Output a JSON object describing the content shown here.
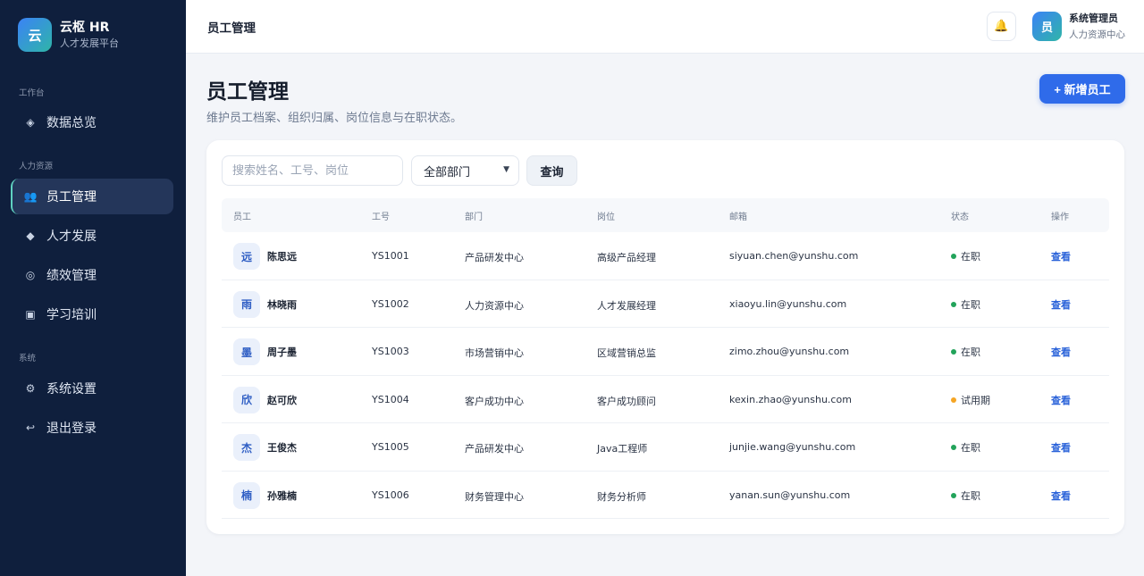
{
  "brand": {
    "logo": "云",
    "title": "云枢 HR",
    "subtitle": "人才发展平台"
  },
  "sidebar": {
    "sections": [
      "工作台",
      "人力资源",
      "系统"
    ],
    "items": [
      {
        "label": "数据总览",
        "icon": "diamond-icon",
        "glyph": "◈"
      },
      {
        "label": "员工管理",
        "icon": "people-icon",
        "glyph": "👥",
        "active": true
      },
      {
        "label": "人才发展",
        "icon": "diamond-solid-icon",
        "glyph": "◆"
      },
      {
        "label": "绩效管理",
        "icon": "target-icon",
        "glyph": "◎"
      },
      {
        "label": "学习培训",
        "icon": "square-icon",
        "glyph": "▣"
      },
      {
        "label": "系统设置",
        "icon": "gear-icon",
        "glyph": "⚙"
      },
      {
        "label": "退出登录",
        "icon": "logout-icon",
        "glyph": "↩"
      }
    ]
  },
  "topbar": {
    "title": "员工管理",
    "bell_icon": "🔔",
    "user": {
      "avatar": "员",
      "name": "系统管理员",
      "role": "人力资源中心"
    }
  },
  "page": {
    "title": "员工管理",
    "description": "维护员工档案、组织归属、岗位信息与在职状态。",
    "add_button": "+ 新增员工"
  },
  "filters": {
    "search_placeholder": "搜索姓名、工号、岗位",
    "department_selected": "全部部门",
    "query_button": "查询"
  },
  "table": {
    "columns": [
      "员工",
      "工号",
      "部门",
      "岗位",
      "邮箱",
      "状态",
      "操作"
    ],
    "rows": [
      {
        "avatar": "远",
        "name": "陈思远",
        "id": "YS1001",
        "dept": "产品研发中心",
        "position": "高级产品经理",
        "email": "siyuan.chen@yunshu.com",
        "status": "在职",
        "action": "查看"
      },
      {
        "avatar": "雨",
        "name": "林晓雨",
        "id": "YS1002",
        "dept": "人力资源中心",
        "position": "人才发展经理",
        "email": "xiaoyu.lin@yunshu.com",
        "status": "在职",
        "action": "查看"
      },
      {
        "avatar": "墨",
        "name": "周子墨",
        "id": "YS1003",
        "dept": "市场营销中心",
        "position": "区域营销总监",
        "email": "zimo.zhou@yunshu.com",
        "status": "在职",
        "action": "查看"
      },
      {
        "avatar": "欣",
        "name": "赵可欣",
        "id": "YS1004",
        "dept": "客户成功中心",
        "position": "客户成功顾问",
        "email": "kexin.zhao@yunshu.com",
        "status": "试用期",
        "action": "查看"
      },
      {
        "avatar": "杰",
        "name": "王俊杰",
        "id": "YS1005",
        "dept": "产品研发中心",
        "position": "Java工程师",
        "email": "junjie.wang@yunshu.com",
        "status": "在职",
        "action": "查看"
      },
      {
        "avatar": "楠",
        "name": "孙雅楠",
        "id": "YS1006",
        "dept": "财务管理中心",
        "position": "财务分析师",
        "email": "yanan.sun@yunshu.com",
        "status": "在职",
        "action": "查看"
      }
    ]
  },
  "colors": {
    "sidebar_bg": "#0f1f3d",
    "accent": "#2f6bea",
    "status_active": "#22a35a",
    "status_probation": "#f5a524"
  }
}
